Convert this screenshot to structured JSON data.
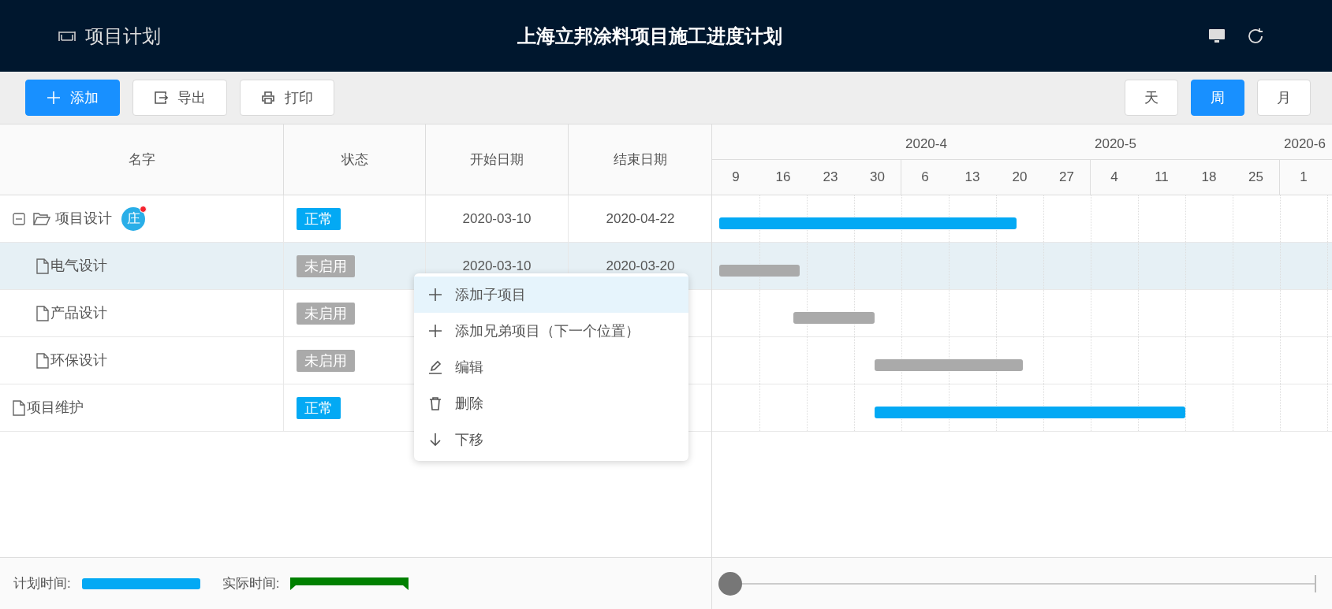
{
  "header": {
    "app_title": "项目计划",
    "page_title": "上海立邦涂料项目施工进度计划"
  },
  "toolbar": {
    "actions": [
      {
        "label": "添加",
        "kind": "add",
        "primary": true
      },
      {
        "label": "导出",
        "kind": "export",
        "primary": false
      },
      {
        "label": "打印",
        "kind": "print",
        "primary": false
      }
    ],
    "scales": [
      {
        "label": "天",
        "selected": false
      },
      {
        "label": "周",
        "selected": true
      },
      {
        "label": "月",
        "selected": false
      }
    ]
  },
  "table": {
    "columns": [
      "名字",
      "状态",
      "开始日期",
      "结束日期"
    ],
    "rows": [
      {
        "name": "项目设计",
        "status": "正常",
        "kind": "normal",
        "start": "2020-03-10",
        "end": "2020-04-22",
        "expanded": true,
        "selected": false,
        "avatar": "庄",
        "children": [
          {
            "name": "电气设计",
            "status": "未启用",
            "kind": "inactive",
            "start": "2020-03-10",
            "end": "2020-03-20",
            "selected": true
          },
          {
            "name": "产品设计",
            "status": "未启用",
            "kind": "inactive",
            "selected": false
          },
          {
            "name": "环保设计",
            "status": "未启用",
            "kind": "inactive",
            "selected": false
          }
        ]
      },
      {
        "name": "项目维护",
        "status": "正常",
        "kind": "normal",
        "selected": false
      }
    ]
  },
  "timeline": {
    "lead_weeks": [
      "9",
      "16",
      "23",
      "30"
    ],
    "months": [
      {
        "label": "2020-4",
        "weeks": [
          "6",
          "13",
          "20",
          "27"
        ]
      },
      {
        "label": "2020-5",
        "weeks": [
          "4",
          "11",
          "18",
          "25"
        ]
      },
      {
        "label": "2020-6",
        "weeks": [
          "1"
        ]
      }
    ]
  },
  "context_menu": [
    {
      "label": "添加子项目",
      "kind": "add",
      "selected": true
    },
    {
      "label": "添加兄弟项目（下一个位置）",
      "kind": "add",
      "selected": false
    },
    {
      "label": "编辑",
      "kind": "edit",
      "selected": false
    },
    {
      "label": "删除",
      "kind": "delete",
      "selected": false
    },
    {
      "label": "下移",
      "kind": "down",
      "selected": false
    }
  ],
  "legend": [
    {
      "label": "计划时间:",
      "kind": "planned"
    },
    {
      "label": "实际时间:",
      "kind": "actual"
    }
  ],
  "zoom_slider": {
    "level": 0
  }
}
